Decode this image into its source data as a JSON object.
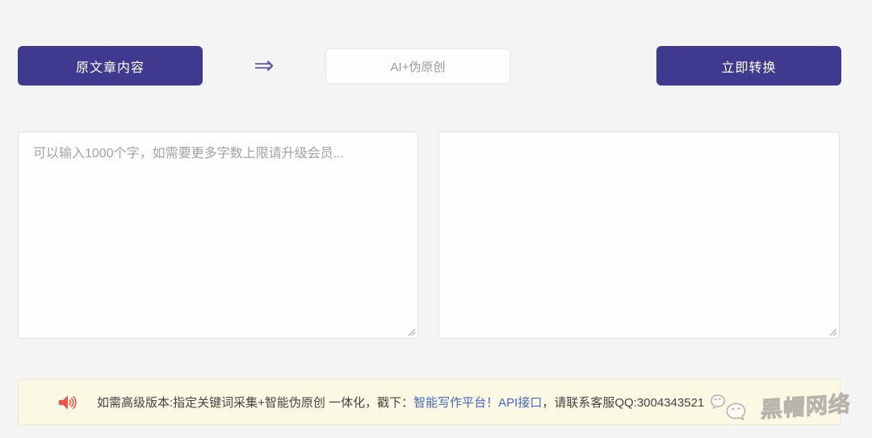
{
  "converter": {
    "source_button_label": "原文章内容",
    "arrow_glyph": "⇒",
    "mode_label": "AI+伪原创",
    "convert_button_label": "立即转换",
    "source_placeholder": "可以输入1000个字，如需要更多字数上限请升级会员...",
    "source_value": "",
    "result_value": ""
  },
  "notice": {
    "segments": [
      {
        "text": "如需高级版本:指定关键词采集+智能伪原创 一体化，戳下：",
        "link": false
      },
      {
        "text": "智能写作平台",
        "link": true
      },
      {
        "text": "！",
        "link": true
      },
      {
        "text": "API接口",
        "link": true
      },
      {
        "text": "，请联系客服QQ:3004343521",
        "link": false
      }
    ]
  },
  "watermark": {
    "text": "黑帽网络"
  },
  "icons": {
    "speaker": "speaker-icon",
    "arrow": "double-arrow-icon",
    "wechat": "wechat-bubbles-icon",
    "resize_grip": "resize-grip-icon"
  },
  "colors": {
    "accent_purple": "#3f3a90",
    "arrow_purple": "#5b55b5",
    "link_blue": "#4468c8",
    "notice_bg": "#fbf8e3",
    "speaker_red": "#f0544c",
    "page_bg": "#f5f4f4"
  }
}
